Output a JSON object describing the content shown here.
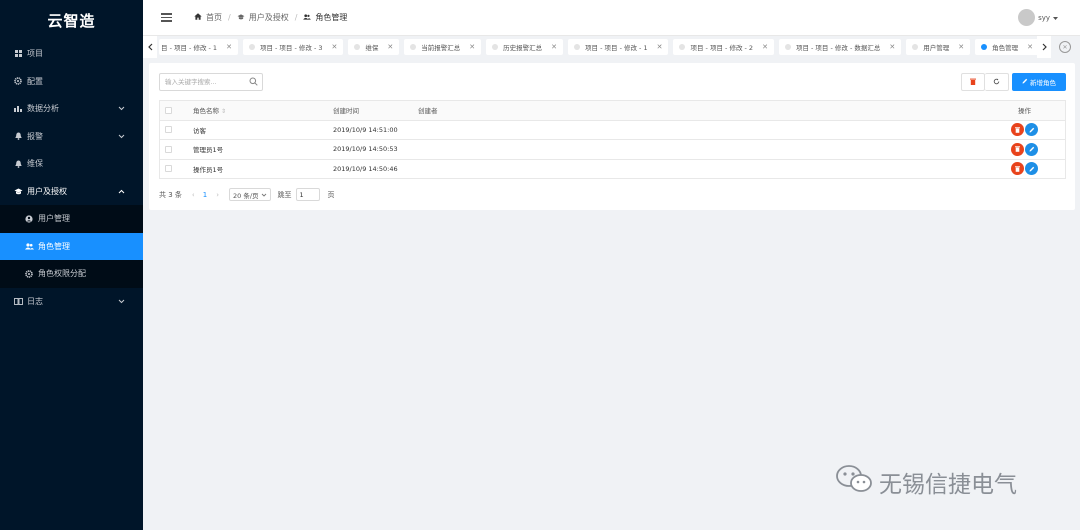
{
  "app": {
    "title": "云智造"
  },
  "sidebar": {
    "items": [
      {
        "label": "项目",
        "icon": "grid-icon"
      },
      {
        "label": "配置",
        "icon": "gear-icon"
      },
      {
        "label": "数据分析",
        "icon": "bar-chart-icon",
        "expandable": true
      },
      {
        "label": "报警",
        "icon": "bell-icon",
        "expandable": true
      },
      {
        "label": "维保",
        "icon": "bell-icon"
      },
      {
        "label": "用户及授权",
        "icon": "mortarboard-icon",
        "expandable": true,
        "expanded": true
      },
      {
        "label": "日志",
        "icon": "book-icon",
        "expandable": true
      }
    ],
    "submenu": [
      {
        "label": "用户管理",
        "icon": "user-icon"
      },
      {
        "label": "角色管理",
        "icon": "users-icon",
        "active": true
      },
      {
        "label": "角色权限分配",
        "icon": "gear-icon"
      }
    ]
  },
  "header": {
    "breadcrumb": [
      {
        "label": "首页",
        "icon": "home-icon"
      },
      {
        "label": "用户及授权",
        "icon": "mortarboard-icon"
      },
      {
        "label": "角色管理",
        "icon": "users-icon"
      }
    ],
    "user": {
      "name": "syy"
    }
  },
  "tabs": [
    {
      "label": "目 - 项目 - 修改 - 1"
    },
    {
      "label": "项目 - 项目 - 修改 - 3"
    },
    {
      "label": "维保"
    },
    {
      "label": "当前报警汇总"
    },
    {
      "label": "历史报警汇总"
    },
    {
      "label": "项目 - 项目 - 修改 - 1"
    },
    {
      "label": "项目 - 项目 - 修改 - 2"
    },
    {
      "label": "项目 - 项目 - 修改 - 数据汇总"
    },
    {
      "label": "用户管理"
    },
    {
      "label": "角色管理",
      "active": true
    }
  ],
  "toolbar": {
    "search_placeholder": "输入关键字搜索...",
    "add_label": "新增角色"
  },
  "table": {
    "columns": {
      "name": "角色名称",
      "created_time": "创建时间",
      "creator": "创建者",
      "ops": "操作"
    },
    "rows": [
      {
        "name": "访客",
        "created_time": "2019/10/9 14:51:00",
        "creator": ""
      },
      {
        "name": "管理员1号",
        "created_time": "2019/10/9 14:50:53",
        "creator": ""
      },
      {
        "name": "操作员1号",
        "created_time": "2019/10/9 14:50:46",
        "creator": ""
      }
    ]
  },
  "pagination": {
    "total": "共 3 条",
    "current": "1",
    "page_size": "20 条/页",
    "jump_label": "跳至",
    "jump_value": "1",
    "page_suffix": "页"
  },
  "watermark": {
    "text": "无锡信捷电气"
  },
  "colors": {
    "sidebar": "#001529",
    "primary": "#1890ff",
    "danger": "#e8431c",
    "edit": "#1e8fe6"
  }
}
